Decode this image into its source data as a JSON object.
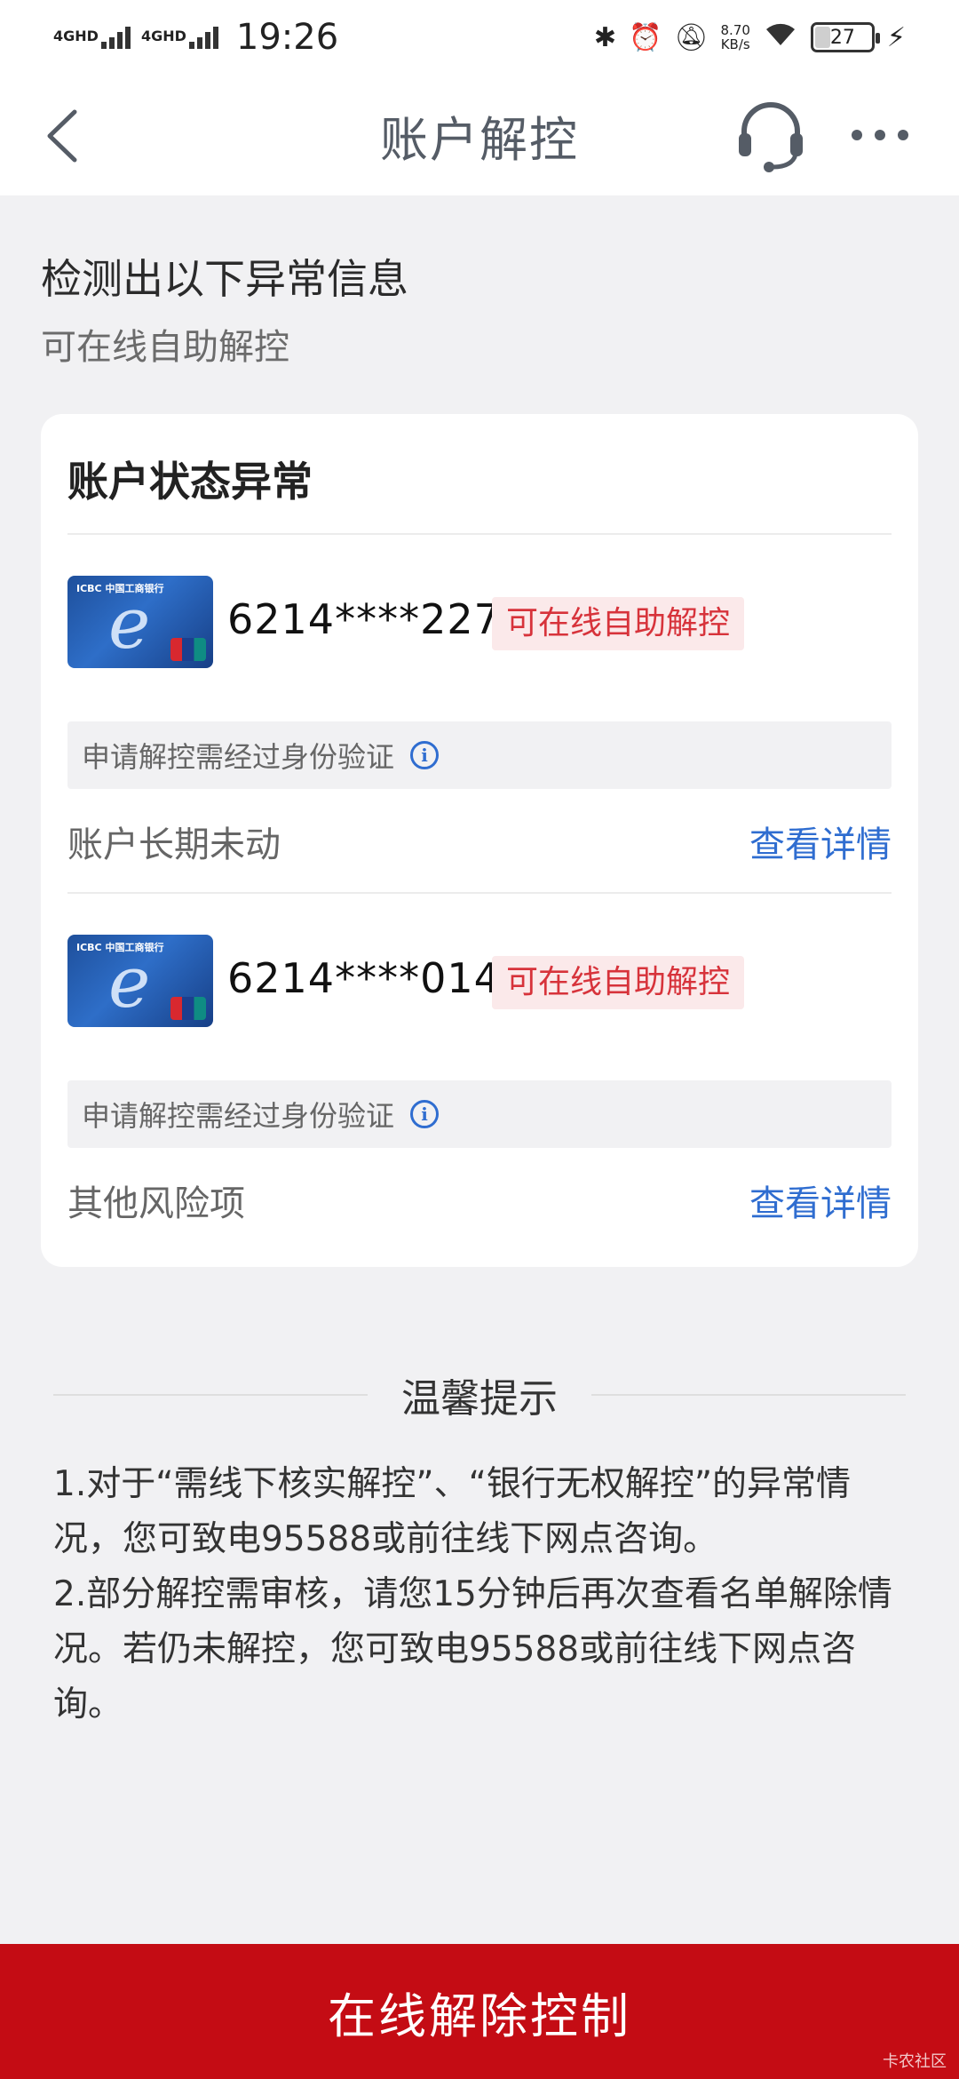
{
  "status_bar": {
    "signal_1": "4GHD",
    "signal_2": "4GHD",
    "time": "19:26",
    "net_speed_value": "8.70",
    "net_speed_unit": "KB/s",
    "battery": "27",
    "battery_level": 0.27
  },
  "nav": {
    "title": "账户解控",
    "back_icon": "chevron-left-icon",
    "service_icon": "headset-icon",
    "more_icon": "more-dots-icon"
  },
  "header": {
    "title": "检测出以下异常信息",
    "subtitle": "可在线自助解控"
  },
  "card": {
    "title": "账户状态异常",
    "accounts": [
      {
        "card_brand": "ICBC 中国工商银行",
        "number": "6214****2274",
        "tag": "可在线自助解控",
        "verify_note": "申请解控需经过身份验证",
        "reason": "账户长期未动",
        "detail_link": "查看详情"
      },
      {
        "card_brand": "ICBC 中国工商银行",
        "number": "6214****0146",
        "tag": "可在线自助解控",
        "verify_note": "申请解控需经过身份验证",
        "reason": "其他风险项",
        "detail_link": "查看详情"
      }
    ]
  },
  "tips": {
    "title": "温馨提示",
    "line_1": "1.对于“需线下核实解控”、“银行无权解控”的异常情况，您可致电95588或前往线下网点咨询。",
    "line_2": "2.部分解控需审核，请您15分钟后再次查看名单解除情况。若仍未解控，您可致电95588或前往线下网点咨询。"
  },
  "bottom_button": {
    "label": "在线解除控制"
  },
  "watermark": "卡农社区",
  "colors": {
    "accent_red": "#c40c14",
    "link_blue": "#2f6dd0",
    "tag_bg": "#fbe9ea",
    "tag_text": "#d7333b",
    "page_bg": "#f1f1f3"
  }
}
